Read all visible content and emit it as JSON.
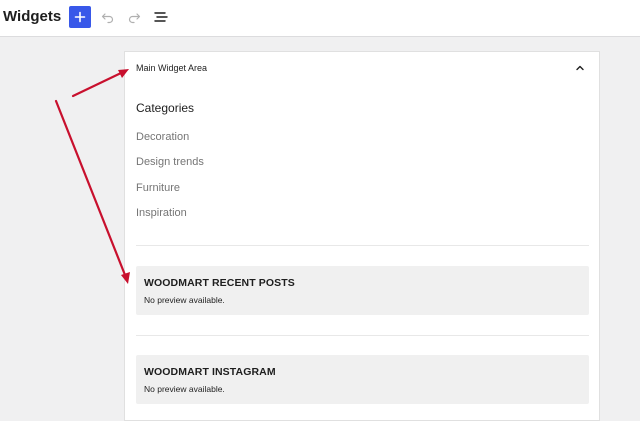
{
  "header": {
    "title": "Widgets",
    "add_icon": "plus-icon",
    "undo_icon": "undo-icon",
    "redo_icon": "redo-icon",
    "list_view_icon": "list-view-icon"
  },
  "widget_area": {
    "title": "Main Widget Area",
    "collapse_icon": "chevron-up-icon",
    "categories": {
      "heading": "Categories",
      "items": [
        "Decoration",
        "Design trends",
        "Furniture",
        "Inspiration"
      ]
    },
    "widgets": [
      {
        "title": "WOODMART RECENT POSTS",
        "note": "No preview available."
      },
      {
        "title": "WOODMART INSTAGRAM",
        "note": "No preview available."
      }
    ]
  },
  "colors": {
    "accent": "#3858e9",
    "arrow": "#c8102e",
    "muted_text": "#757575",
    "canvas_bg": "#f0f0f1"
  }
}
